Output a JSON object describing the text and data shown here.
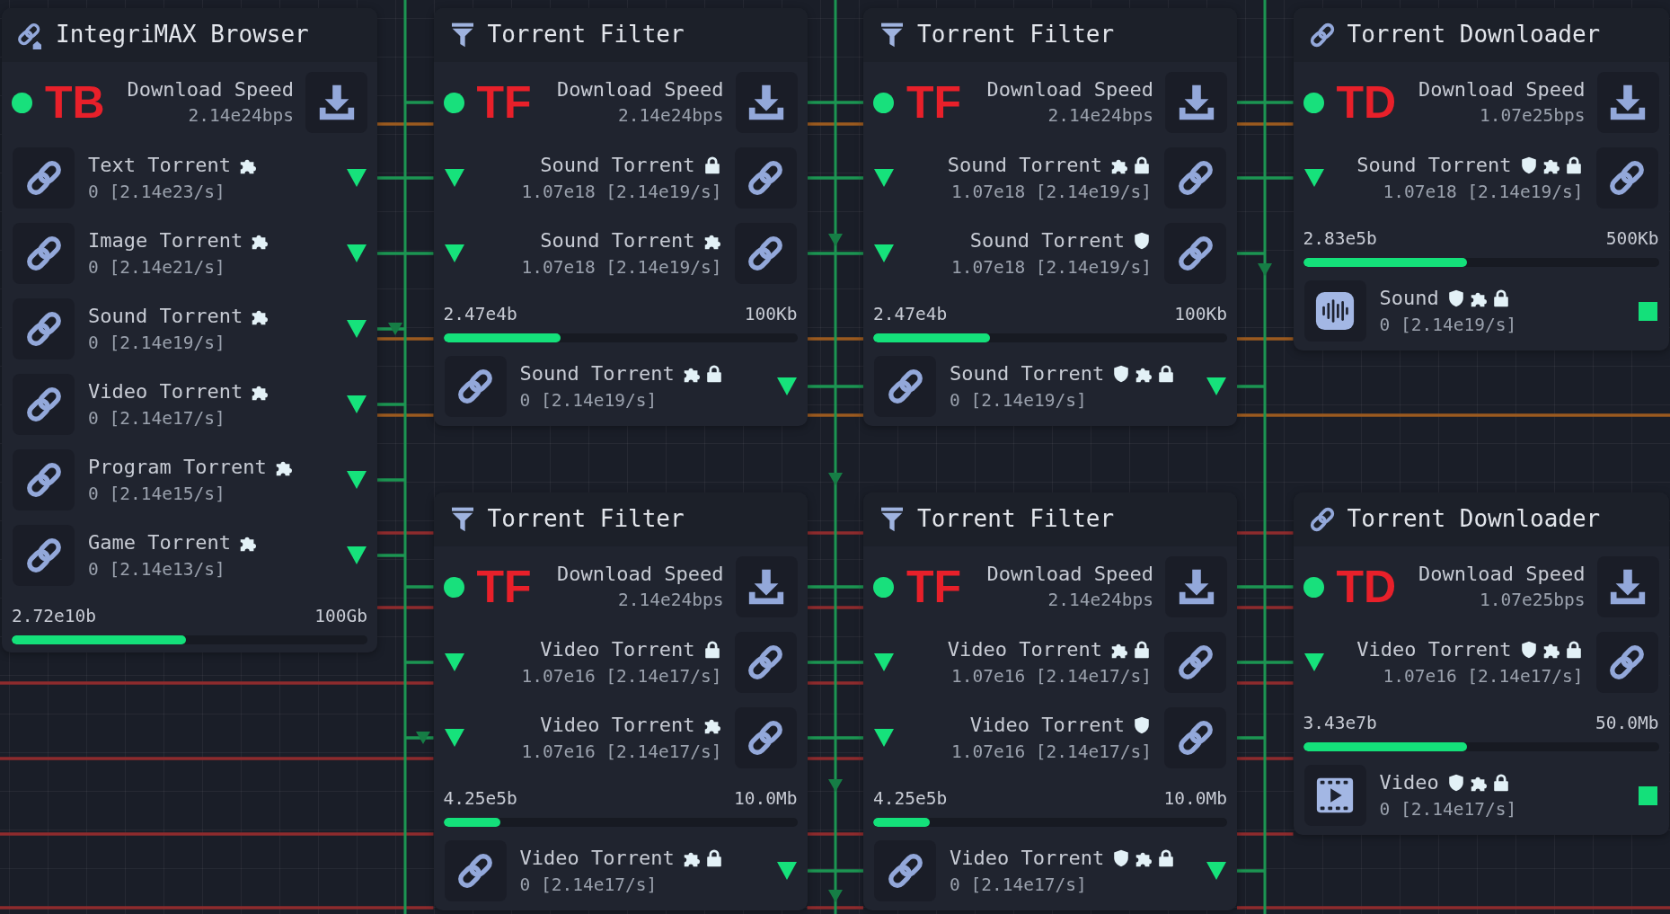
{
  "nodes": [
    {
      "kind": "browser",
      "title": "IntegriMAX Browser",
      "online": true,
      "badge": "TB",
      "speed": {
        "label": "Download Speed",
        "value": "2.14e24bps"
      },
      "rows": [
        {
          "kind": "output",
          "name": "Text Torrent",
          "value": "0 [2.14e23/s]",
          "flags": {
            "shield": false,
            "puzzle": true,
            "lock": false
          }
        },
        {
          "kind": "output",
          "name": "Image Torrent",
          "value": "0 [2.14e21/s]",
          "flags": {
            "shield": false,
            "puzzle": true,
            "lock": false
          }
        },
        {
          "kind": "output",
          "name": "Sound Torrent",
          "value": "0 [2.14e19/s]",
          "flags": {
            "shield": false,
            "puzzle": true,
            "lock": false
          }
        },
        {
          "kind": "output",
          "name": "Video Torrent",
          "value": "0 [2.14e17/s]",
          "flags": {
            "shield": false,
            "puzzle": true,
            "lock": false
          }
        },
        {
          "kind": "output",
          "name": "Program Torrent",
          "value": "0 [2.14e15/s]",
          "flags": {
            "shield": false,
            "puzzle": true,
            "lock": false
          }
        },
        {
          "kind": "output",
          "name": "Game Torrent",
          "value": "0 [2.14e13/s]",
          "flags": {
            "shield": false,
            "puzzle": true,
            "lock": false
          }
        },
        {
          "kind": "progress",
          "value": "2.72e10b",
          "limit": "100Gb",
          "level": 0.49
        }
      ]
    },
    {
      "kind": "filter",
      "title": "Torrent Filter",
      "online": true,
      "badge": "TF",
      "speed": {
        "label": "Download Speed",
        "value": "2.14e24bps"
      },
      "rows": [
        {
          "kind": "input",
          "name": "Sound Torrent",
          "value": "1.07e18 [2.14e19/s]",
          "flags": {
            "shield": false,
            "puzzle": false,
            "lock": true
          }
        },
        {
          "kind": "input",
          "name": "Sound Torrent",
          "value": "1.07e18 [2.14e19/s]",
          "flags": {
            "shield": false,
            "puzzle": true,
            "lock": false
          }
        },
        {
          "kind": "progress",
          "value": "2.47e4b",
          "limit": "100Kb",
          "level": 0.33
        },
        {
          "kind": "output",
          "name": "Sound Torrent",
          "value": "0 [2.14e19/s]",
          "flags": {
            "shield": false,
            "puzzle": true,
            "lock": true
          }
        }
      ]
    },
    {
      "kind": "filter",
      "title": "Torrent Filter",
      "online": true,
      "badge": "TF",
      "speed": {
        "label": "Download Speed",
        "value": "2.14e24bps"
      },
      "rows": [
        {
          "kind": "input",
          "name": "Sound Torrent",
          "value": "1.07e18 [2.14e19/s]",
          "flags": {
            "shield": false,
            "puzzle": true,
            "lock": true
          }
        },
        {
          "kind": "input",
          "name": "Sound Torrent",
          "value": "1.07e18 [2.14e19/s]",
          "flags": {
            "shield": true,
            "puzzle": false,
            "lock": false
          }
        },
        {
          "kind": "progress",
          "value": "2.47e4b",
          "limit": "100Kb",
          "level": 0.33
        },
        {
          "kind": "output",
          "name": "Sound Torrent",
          "value": "0 [2.14e19/s]",
          "flags": {
            "shield": true,
            "puzzle": true,
            "lock": true
          }
        }
      ]
    },
    {
      "kind": "downloader",
      "title": "Torrent Downloader",
      "online": true,
      "badge": "TD",
      "speed": {
        "label": "Download Speed",
        "value": "1.07e25bps"
      },
      "rows": [
        {
          "kind": "input",
          "name": "Sound Torrent",
          "value": "1.07e18 [2.14e19/s]",
          "flags": {
            "shield": true,
            "puzzle": true,
            "lock": true
          }
        },
        {
          "kind": "progress",
          "value": "2.83e5b",
          "limit": "500Kb",
          "level": 0.46
        },
        {
          "kind": "sound_file",
          "name": "Sound",
          "value": "0 [2.14e19/s]",
          "flags": {
            "shield": true,
            "puzzle": true,
            "lock": true
          }
        }
      ]
    },
    {
      "kind": "filter",
      "title": "Torrent Filter",
      "online": true,
      "badge": "TF",
      "speed": {
        "label": "Download Speed",
        "value": "2.14e24bps"
      },
      "rows": [
        {
          "kind": "input",
          "name": "Video Torrent",
          "value": "1.07e16 [2.14e17/s]",
          "flags": {
            "shield": false,
            "puzzle": false,
            "lock": true
          }
        },
        {
          "kind": "input",
          "name": "Video Torrent",
          "value": "1.07e16 [2.14e17/s]",
          "flags": {
            "shield": false,
            "puzzle": true,
            "lock": false
          }
        },
        {
          "kind": "progress",
          "value": "4.25e5b",
          "limit": "10.0Mb",
          "level": 0.16
        },
        {
          "kind": "output",
          "name": "Video Torrent",
          "value": "0 [2.14e17/s]",
          "flags": {
            "shield": false,
            "puzzle": true,
            "lock": true
          }
        }
      ]
    },
    {
      "kind": "filter",
      "title": "Torrent Filter",
      "online": true,
      "badge": "TF",
      "speed": {
        "label": "Download Speed",
        "value": "2.14e24bps"
      },
      "rows": [
        {
          "kind": "input",
          "name": "Video Torrent",
          "value": "1.07e16 [2.14e17/s]",
          "flags": {
            "shield": false,
            "puzzle": true,
            "lock": true
          }
        },
        {
          "kind": "input",
          "name": "Video Torrent",
          "value": "1.07e16 [2.14e17/s]",
          "flags": {
            "shield": true,
            "puzzle": false,
            "lock": false
          }
        },
        {
          "kind": "progress",
          "value": "4.25e5b",
          "limit": "10.0Mb",
          "level": 0.16
        },
        {
          "kind": "output",
          "name": "Video Torrent",
          "value": "0 [2.14e17/s]",
          "flags": {
            "shield": true,
            "puzzle": true,
            "lock": true
          }
        }
      ]
    },
    {
      "kind": "downloader",
      "title": "Torrent Downloader",
      "online": true,
      "badge": "TD",
      "speed": {
        "label": "Download Speed",
        "value": "1.07e25bps"
      },
      "rows": [
        {
          "kind": "input",
          "name": "Video Torrent",
          "value": "1.07e16 [2.14e17/s]",
          "flags": {
            "shield": true,
            "puzzle": true,
            "lock": true
          }
        },
        {
          "kind": "progress",
          "value": "3.43e7b",
          "limit": "50.0Mb",
          "level": 0.46
        },
        {
          "kind": "video_file",
          "name": "Video",
          "value": "0 [2.14e17/s]",
          "flags": {
            "shield": true,
            "puzzle": true,
            "lock": true
          }
        }
      ]
    }
  ]
}
